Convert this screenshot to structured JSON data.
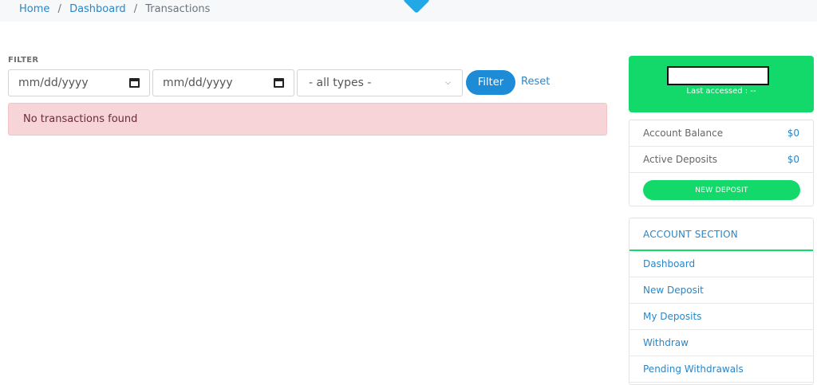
{
  "breadcrumb": {
    "home": "Home",
    "separator": "/",
    "dashboard": "Dashboard",
    "current": "Transactions"
  },
  "filter": {
    "label": "FILTER",
    "date_from_placeholder": "mm/dd/yyyy",
    "date_to_placeholder": "mm/dd/yyyy",
    "type_selected": "- all types -",
    "filter_label": "Filter",
    "reset_label": "Reset"
  },
  "alert": {
    "message": "No transactions found"
  },
  "account": {
    "last_accessed": "Last accessed : --",
    "balance_label": "Account Balance",
    "balance_value": "$0",
    "active_label": "Active Deposits",
    "active_value": "$0",
    "new_deposit_label": "NEW DEPOSIT"
  },
  "account_section": {
    "title": "ACCOUNT SECTION",
    "items": [
      "Dashboard",
      "New Deposit",
      "My Deposits",
      "Withdraw",
      "Pending Withdrawals"
    ]
  },
  "colors": {
    "accent_blue": "#1e8bd6",
    "link_blue": "#2b86c7",
    "brand_green": "#12d96a",
    "alert_bg": "#f6d4d8"
  },
  "icons": {
    "date": "calendar-icon",
    "select": "chevron-down-icon"
  }
}
